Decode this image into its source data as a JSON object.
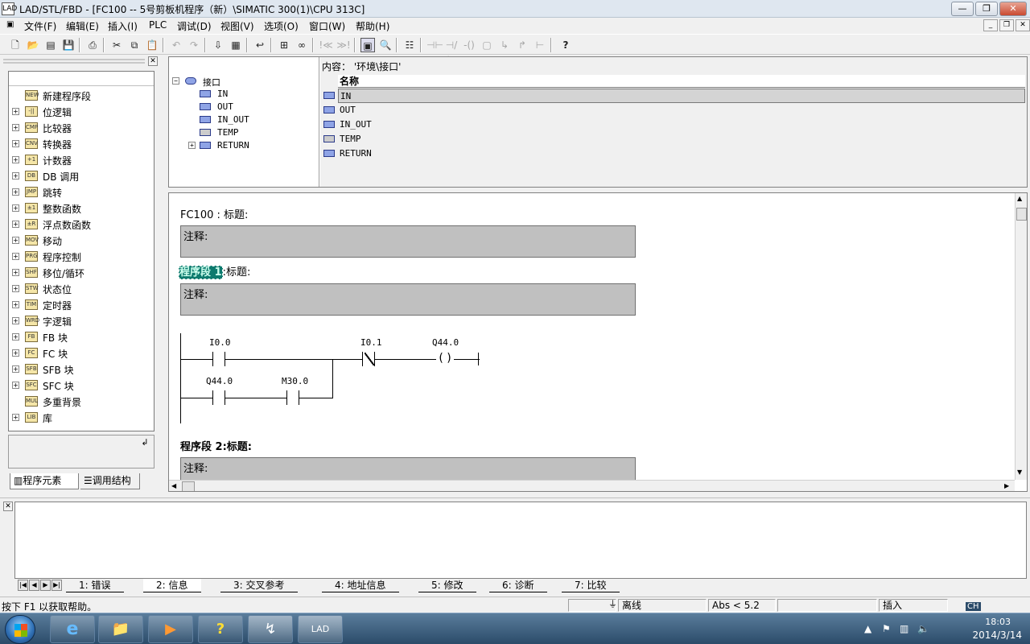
{
  "window": {
    "icon": "LAD",
    "title": "LAD/STL/FBD  - [FC100 -- 5号剪板机程序（新）\\SIMATIC 300(1)\\CPU 313C]",
    "min": "—",
    "max": "❐",
    "close": "✕"
  },
  "menu": {
    "items": [
      "文件(F)",
      "编辑(E)",
      "插入(I)",
      "PLC",
      "调试(D)",
      "视图(V)",
      "选项(O)",
      "窗口(W)",
      "帮助(H)"
    ],
    "mdi_min": "_",
    "mdi_max": "❐",
    "mdi_close": "✕"
  },
  "toolbar": {
    "buttons": [
      "new-icon",
      "open-icon",
      "accessible-icon",
      "save-icon",
      "print-icon",
      "cut-icon",
      "copy-icon",
      "paste-icon",
      "undo-icon",
      "redo-icon",
      "load-icon",
      "online-icon",
      "back-icon",
      "network-icon",
      "view-icon",
      "prev-icon",
      "next-icon",
      "overview-icon",
      "detail-icon",
      "new-network-icon",
      "contact-icon",
      "nc-contact-icon",
      "coil-icon",
      "box-icon",
      "branch-open-icon",
      "branch-close-icon",
      "connection-icon",
      "help-icon"
    ]
  },
  "left_panel": {
    "close": "✕",
    "tree": [
      {
        "label": "新建程序段",
        "icon": "NEW",
        "expand": false
      },
      {
        "label": "位逻辑",
        "icon": "-||",
        "expand": true
      },
      {
        "label": "比较器",
        "icon": "CMP",
        "expand": true
      },
      {
        "label": "转换器",
        "icon": "CNV",
        "expand": true
      },
      {
        "label": "计数器",
        "icon": "+1",
        "expand": true
      },
      {
        "label": "DB 调用",
        "icon": "DB",
        "expand": true
      },
      {
        "label": "跳转",
        "icon": "JMP",
        "expand": true
      },
      {
        "label": "整数函数",
        "icon": "±1",
        "expand": true
      },
      {
        "label": "浮点数函数",
        "icon": "±R",
        "expand": true
      },
      {
        "label": "移动",
        "icon": "MOV",
        "expand": true
      },
      {
        "label": "程序控制",
        "icon": "PRG",
        "expand": true
      },
      {
        "label": "移位/循环",
        "icon": "SHF",
        "expand": true
      },
      {
        "label": "状态位",
        "icon": "STW",
        "expand": true
      },
      {
        "label": "定时器",
        "icon": "TIM",
        "expand": true
      },
      {
        "label": "字逻辑",
        "icon": "WRD",
        "expand": true
      },
      {
        "label": "FB 块",
        "icon": "FB",
        "expand": true
      },
      {
        "label": "FC 块",
        "icon": "FC",
        "expand": true
      },
      {
        "label": "SFB 块",
        "icon": "SFB",
        "expand": true
      },
      {
        "label": "SFC 块",
        "icon": "SFC",
        "expand": true
      },
      {
        "label": "多重背景",
        "icon": "MUL",
        "expand": false
      },
      {
        "label": "库",
        "icon": "LIB",
        "expand": true
      }
    ],
    "info_btn": "↲",
    "tabs": [
      "程序元素",
      "调用结构"
    ]
  },
  "interface": {
    "root": "接口",
    "tree": [
      "IN",
      "OUT",
      "IN_OUT",
      "TEMP",
      "RETURN"
    ],
    "content_title": "内容：  '环境\\接口'",
    "col_header": "名称",
    "rows": [
      "IN",
      "OUT",
      "IN_OUT",
      "TEMP",
      "RETURN"
    ]
  },
  "code": {
    "block_title": "FC100 : 标题:",
    "comment_label": "注释:",
    "segment1_label": "程序段 1",
    "segment1_title": ":标题:",
    "segment2_title": "程序段 2:标题:",
    "ladder": {
      "c1": "I0.0",
      "c2": "I0.1",
      "coil": "Q44.0",
      "b1": "Q44.0",
      "b2": "M30.0",
      "coil_symbol": "( )"
    }
  },
  "output": {
    "close": "✕",
    "tabs": [
      "1: 错误",
      "2: 信息",
      "3: 交叉参考",
      "4: 地址信息",
      "5: 修改",
      "6: 诊断",
      "7: 比较"
    ],
    "active_tab": 1
  },
  "status": {
    "help": "按下 F1 以获取帮助。",
    "mode": "离线",
    "abs": "Abs < 5.2",
    "insert": "插入"
  },
  "taskbar": {
    "apps": [
      "e",
      "📁",
      "▶",
      "?",
      "↯",
      "LAD"
    ],
    "lang": "CH",
    "time": "18:03",
    "date": "2014/3/14"
  }
}
